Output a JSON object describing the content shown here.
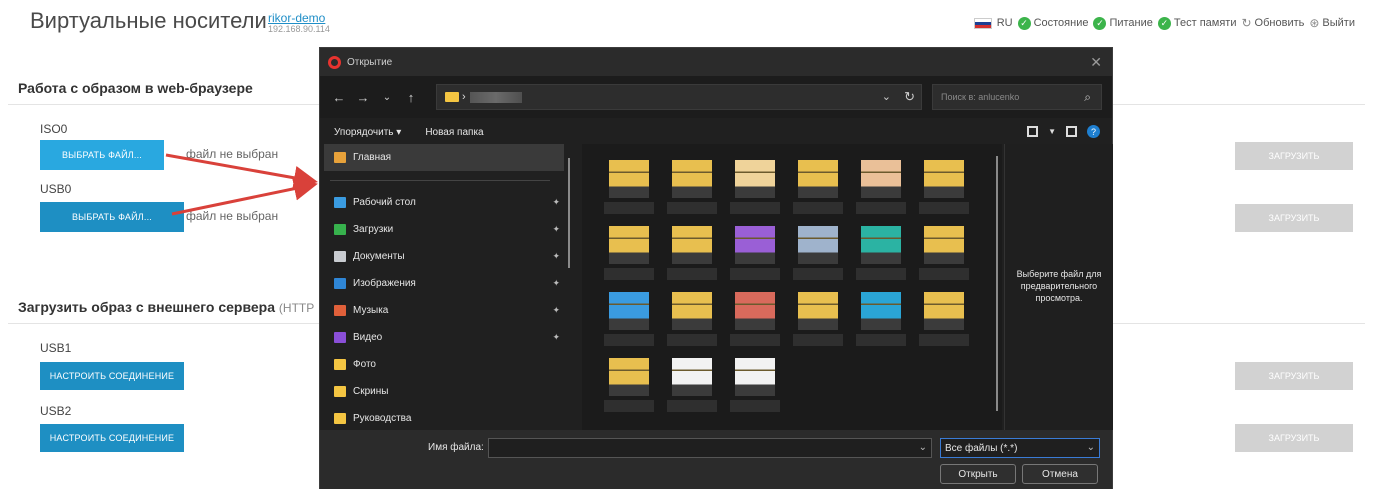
{
  "page": {
    "title": "Виртуальные носители",
    "device_name": "rikor-demo",
    "device_ip": "192.168.90.114"
  },
  "topbar": {
    "language": "RU",
    "status": "Состояние",
    "power": "Питание",
    "memory_test": "Тест памяти",
    "refresh": "Обновить",
    "logout": "Выйти"
  },
  "section_browser": {
    "title": "Работа с образом в web-браузере",
    "devices": [
      {
        "label": "ISO0",
        "choose_label": "ВЫБРАТЬ ФАЙЛ...",
        "file_status": "файл не выбран",
        "upload_label": "ЗАГРУЗИТЬ"
      },
      {
        "label": "USB0",
        "choose_label": "ВЫБРАТЬ ФАЙЛ...",
        "file_status": "файл не выбран",
        "upload_label": "ЗАГРУЗИТЬ"
      }
    ]
  },
  "section_server": {
    "title": "Загрузить образ с внешнего сервера",
    "subtitle": "(HTTP",
    "devices": [
      {
        "label": "USB1",
        "configure_label": "НАСТРОИТЬ СОЕДИНЕНИЕ",
        "upload_label": "ЗАГРУЗИТЬ"
      },
      {
        "label": "USB2",
        "configure_label": "НАСТРОИТЬ СОЕДИНЕНИЕ",
        "upload_label": "ЗАГРУЗИТЬ"
      }
    ]
  },
  "dialog": {
    "title": "Открытие",
    "search_placeholder": "Поиск в: anlucenko",
    "organize": "Упорядочить ▾",
    "new_folder": "Новая папка",
    "sidebar": [
      {
        "label": "Главная",
        "icon": "home-icon",
        "color": "#e8a23a",
        "active": true,
        "pinned": false
      },
      {
        "label": "Рабочий стол",
        "icon": "desktop-icon",
        "color": "#3a9be0",
        "active": false,
        "pinned": true
      },
      {
        "label": "Загрузки",
        "icon": "download-icon",
        "color": "#37b24d",
        "active": false,
        "pinned": true
      },
      {
        "label": "Документы",
        "icon": "document-icon",
        "color": "#c9ccd1",
        "active": false,
        "pinned": true
      },
      {
        "label": "Изображения",
        "icon": "pictures-icon",
        "color": "#2f86d6",
        "active": false,
        "pinned": true
      },
      {
        "label": "Музыка",
        "icon": "music-icon",
        "color": "#e0603a",
        "active": false,
        "pinned": true
      },
      {
        "label": "Видео",
        "icon": "video-icon",
        "color": "#8a4fd8",
        "active": false,
        "pinned": true
      },
      {
        "label": "Фото",
        "icon": "folder-icon",
        "color": "#f4c542",
        "active": false,
        "pinned": false
      },
      {
        "label": "Скрины",
        "icon": "folder-icon",
        "color": "#f4c542",
        "active": false,
        "pinned": false
      },
      {
        "label": "Руководства",
        "icon": "folder-icon",
        "color": "#f4c542",
        "active": false,
        "pinned": false
      }
    ],
    "thumbnails": [
      {
        "color": "#e8bf4f"
      },
      {
        "color": "#e8bf4f"
      },
      {
        "color": "#efd39a"
      },
      {
        "color": "#e8bf4f"
      },
      {
        "color": "#eac098"
      },
      {
        "color": "#e8bf4f"
      },
      {
        "color": "#e8bf4f"
      },
      {
        "color": "#e8bf4f"
      },
      {
        "color": "#9a5fd6"
      },
      {
        "color": "#9fb3cc"
      },
      {
        "color": "#2bb3a3"
      },
      {
        "color": "#e8bf4f"
      },
      {
        "color": "#3a9be0"
      },
      {
        "color": "#e8bf4f"
      },
      {
        "color": "#d96a5c"
      },
      {
        "color": "#e8bf4f"
      },
      {
        "color": "#2aa5d6"
      },
      {
        "color": "#e8bf4f"
      },
      {
        "color": "#e8bf4f"
      },
      {
        "color": "#f2f2f2"
      },
      {
        "color": "#f2f2f2"
      }
    ],
    "preview_text": "Выберите файл для предварительного просмотра.",
    "filename_label": "Имя файла:",
    "filetype": "Все файлы (*.*)",
    "open_label": "Открыть",
    "cancel_label": "Отмена"
  },
  "colors": {
    "accent": "#1e8fc3",
    "accent_light": "#29a8e0",
    "disabled": "#d2d2d2",
    "arrow": "#d9413a"
  }
}
